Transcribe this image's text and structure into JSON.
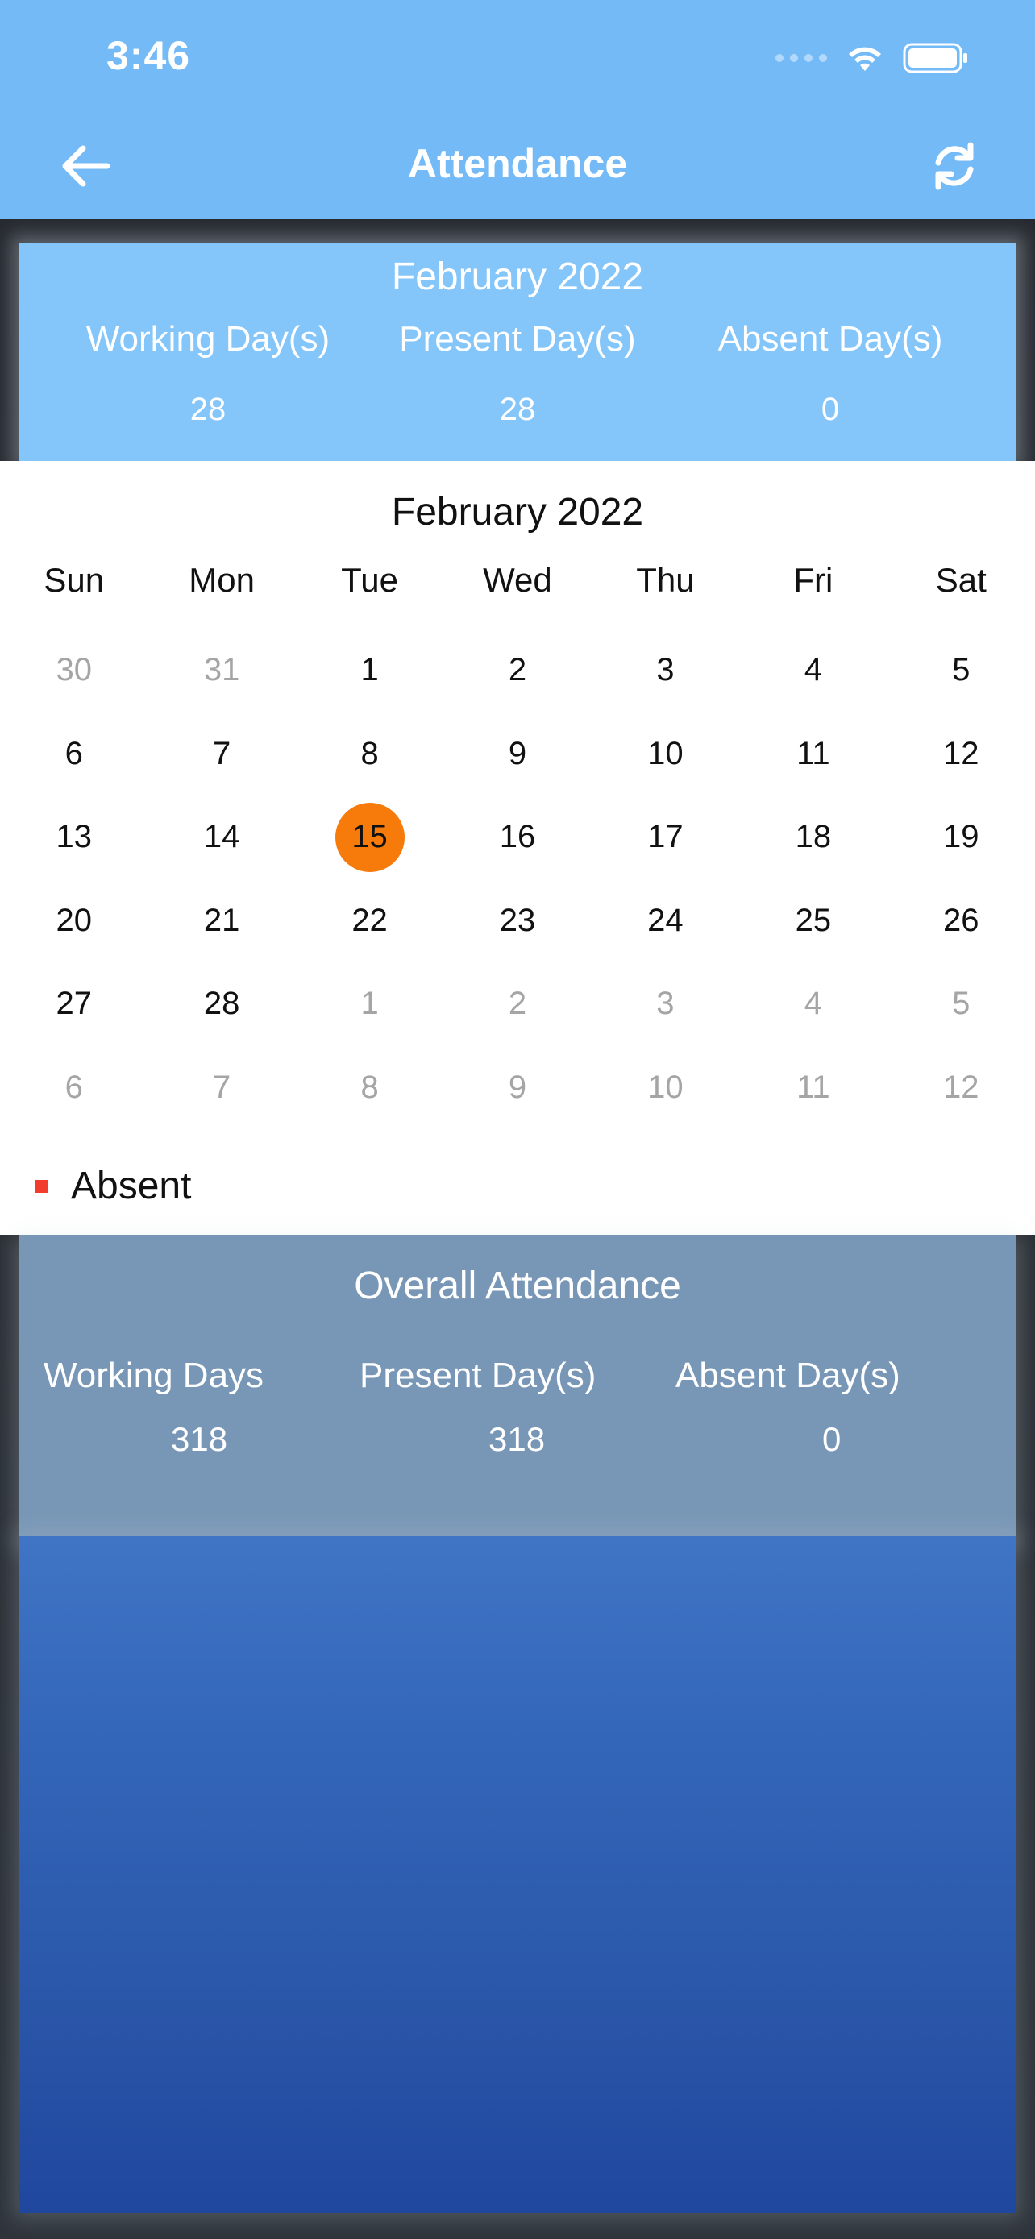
{
  "status": {
    "time": "3:46"
  },
  "nav": {
    "title": "Attendance",
    "back_icon": "arrow-left-icon",
    "refresh_icon": "refresh-icon"
  },
  "month_summary": {
    "title": "February 2022",
    "working_label": "Working Day(s)",
    "working_value": "28",
    "present_label": "Present Day(s)",
    "present_value": "28",
    "absent_label": "Absent Day(s)",
    "absent_value": "0"
  },
  "calendar": {
    "title": "February 2022",
    "weekdays": [
      "Sun",
      "Mon",
      "Tue",
      "Wed",
      "Thu",
      "Fri",
      "Sat"
    ],
    "selected_day": "15",
    "days": [
      {
        "label": "30",
        "other": true
      },
      {
        "label": "31",
        "other": true
      },
      {
        "label": "1",
        "other": false
      },
      {
        "label": "2",
        "other": false
      },
      {
        "label": "3",
        "other": false
      },
      {
        "label": "4",
        "other": false
      },
      {
        "label": "5",
        "other": false
      },
      {
        "label": "6",
        "other": false
      },
      {
        "label": "7",
        "other": false
      },
      {
        "label": "8",
        "other": false
      },
      {
        "label": "9",
        "other": false
      },
      {
        "label": "10",
        "other": false
      },
      {
        "label": "11",
        "other": false
      },
      {
        "label": "12",
        "other": false
      },
      {
        "label": "13",
        "other": false
      },
      {
        "label": "14",
        "other": false
      },
      {
        "label": "15",
        "other": false,
        "today": true
      },
      {
        "label": "16",
        "other": false
      },
      {
        "label": "17",
        "other": false
      },
      {
        "label": "18",
        "other": false
      },
      {
        "label": "19",
        "other": false
      },
      {
        "label": "20",
        "other": false
      },
      {
        "label": "21",
        "other": false
      },
      {
        "label": "22",
        "other": false
      },
      {
        "label": "23",
        "other": false
      },
      {
        "label": "24",
        "other": false
      },
      {
        "label": "25",
        "other": false
      },
      {
        "label": "26",
        "other": false
      },
      {
        "label": "27",
        "other": false
      },
      {
        "label": "28",
        "other": false
      },
      {
        "label": "1",
        "other": true
      },
      {
        "label": "2",
        "other": true
      },
      {
        "label": "3",
        "other": true
      },
      {
        "label": "4",
        "other": true
      },
      {
        "label": "5",
        "other": true
      },
      {
        "label": "6",
        "other": true
      },
      {
        "label": "7",
        "other": true
      },
      {
        "label": "8",
        "other": true
      },
      {
        "label": "9",
        "other": true
      },
      {
        "label": "10",
        "other": true
      },
      {
        "label": "11",
        "other": true
      },
      {
        "label": "12",
        "other": true
      }
    ]
  },
  "legend": {
    "absent_label": "Absent",
    "absent_color": "#f23c2e"
  },
  "overall": {
    "title": "Overall Attendance",
    "working_label": "Working Days",
    "working_value": "318",
    "present_label": "Present Day(s)",
    "present_value": "318",
    "absent_label": "Absent Day(s)",
    "absent_value": "0"
  },
  "colors": {
    "nav_bar": "#73baf7",
    "summary_card": "#84c5fa",
    "today_highlight": "#f77b0b",
    "overall_card": "#7897b7",
    "blue_area": "#2a56a8"
  }
}
